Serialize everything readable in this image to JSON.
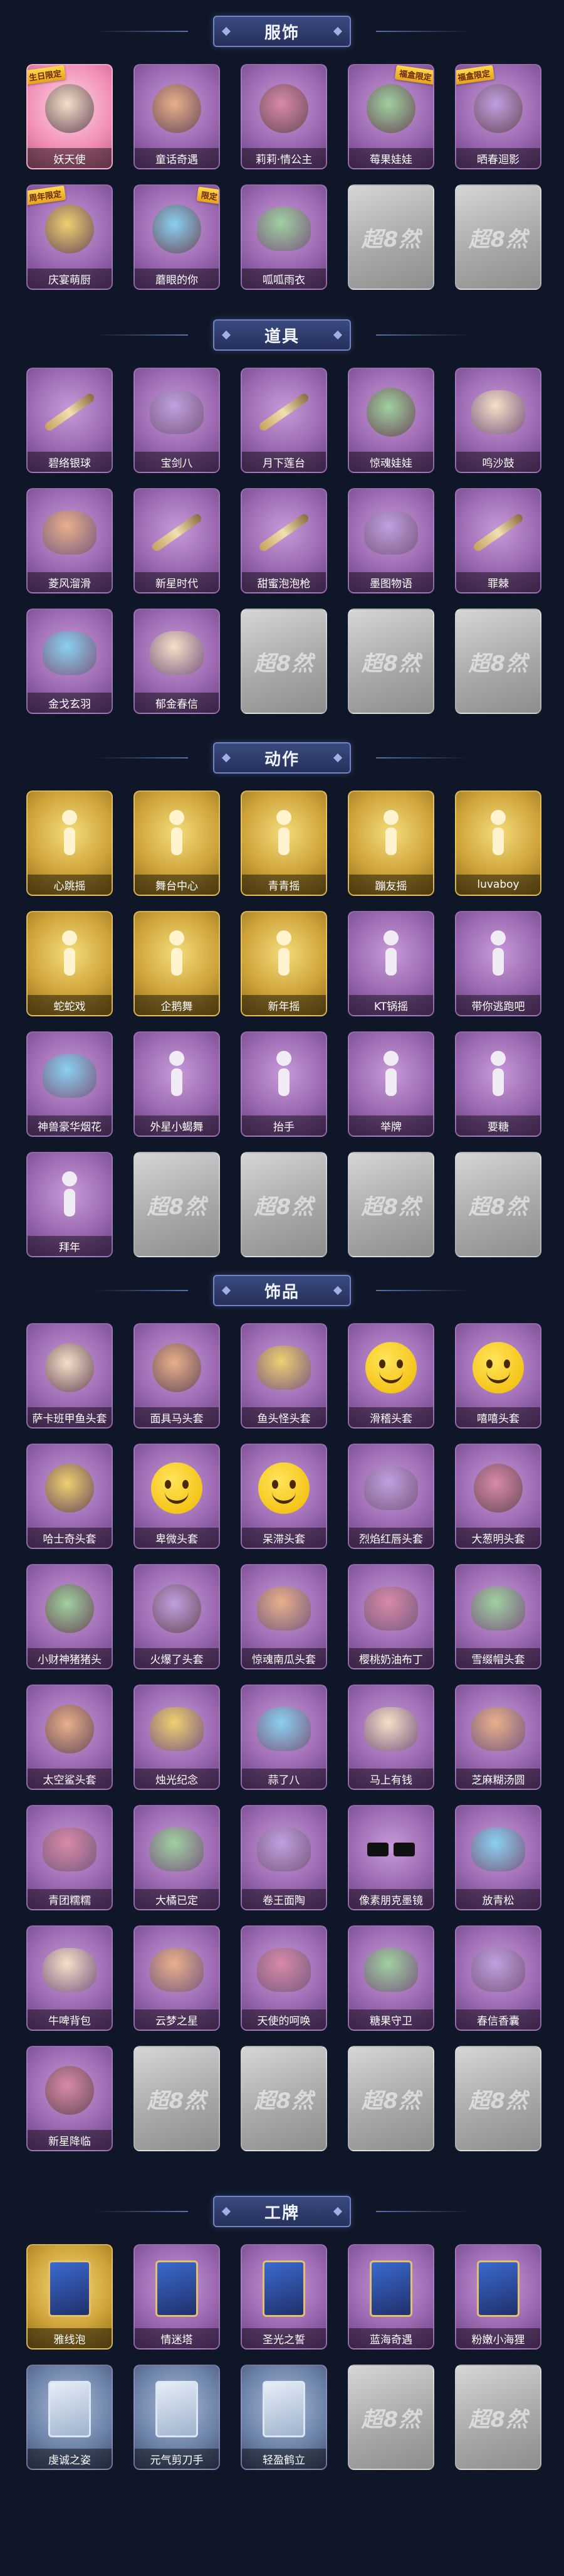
{
  "sections": [
    {
      "title": "服饰",
      "items": [
        {
          "label": "妖天使",
          "rarity": "pink",
          "icon": "angel-avatar-icon",
          "badge": "生日限定"
        },
        {
          "label": "童话奇遇",
          "rarity": "purple",
          "icon": "fairytale-girl-icon",
          "badge": ""
        },
        {
          "label": "莉莉·情公主",
          "rarity": "purple",
          "icon": "pink-princess-icon",
          "badge": ""
        },
        {
          "label": "莓果娃娃",
          "rarity": "purple",
          "icon": "berry-doll-icon",
          "badge": "福盒限定"
        },
        {
          "label": "晒春迴影",
          "rarity": "purple",
          "icon": "spring-boy-icon",
          "badge": "福盒限定"
        },
        {
          "label": "庆宴萌厨",
          "rarity": "purple",
          "icon": "chef-girl-icon",
          "badge": "周年限定"
        },
        {
          "label": "蘑眼的你",
          "rarity": "purple",
          "icon": "hat-girl-icon",
          "badge": "限定"
        },
        {
          "label": "呱呱雨衣",
          "rarity": "purple",
          "icon": "frog-raincoat-icon",
          "badge": ""
        },
        {
          "label": "",
          "rarity": "empty"
        },
        {
          "label": "",
          "rarity": "empty"
        }
      ]
    },
    {
      "title": "道具",
      "items": [
        {
          "label": "碧络银球",
          "rarity": "purple",
          "icon": "bow-weapon-icon"
        },
        {
          "label": "宝剑八",
          "rarity": "purple",
          "icon": "heart-frame-icon"
        },
        {
          "label": "月下莲台",
          "rarity": "purple",
          "icon": "moon-scepter-icon"
        },
        {
          "label": "惊魂娃娃",
          "rarity": "purple",
          "icon": "skull-doll-icon"
        },
        {
          "label": "鸣沙鼓",
          "rarity": "purple",
          "icon": "dreamcatcher-icon"
        },
        {
          "label": "菱风溜滑",
          "rarity": "purple",
          "icon": "ice-skates-icon"
        },
        {
          "label": "新星时代",
          "rarity": "purple",
          "icon": "revolver-icon"
        },
        {
          "label": "甜蜜泡泡枪",
          "rarity": "purple",
          "icon": "bubble-gun-icon"
        },
        {
          "label": "墨图物语",
          "rarity": "purple",
          "icon": "medkit-icon"
        },
        {
          "label": "罪棘",
          "rarity": "purple",
          "icon": "staff-icon"
        },
        {
          "label": "金戈玄羽",
          "rarity": "purple",
          "icon": "lantern-icon"
        },
        {
          "label": "郁金春信",
          "rarity": "purple",
          "icon": "fan-icon"
        },
        {
          "label": "",
          "rarity": "empty"
        },
        {
          "label": "",
          "rarity": "empty"
        },
        {
          "label": "",
          "rarity": "empty"
        }
      ]
    },
    {
      "title": "动作",
      "items": [
        {
          "label": "心跳摇",
          "rarity": "gold",
          "icon": "pose-icon"
        },
        {
          "label": "舞台中心",
          "rarity": "gold",
          "icon": "pose-icon"
        },
        {
          "label": "青青摇",
          "rarity": "gold",
          "icon": "pose-icon"
        },
        {
          "label": "蹦友摇",
          "rarity": "gold",
          "icon": "pose-icon"
        },
        {
          "label": "luvaboy",
          "rarity": "gold",
          "icon": "pose-icon"
        },
        {
          "label": "蛇蛇戏",
          "rarity": "gold",
          "icon": "pose-icon"
        },
        {
          "label": "企鹅舞",
          "rarity": "gold",
          "icon": "pose-icon"
        },
        {
          "label": "新年摇",
          "rarity": "gold",
          "icon": "pose-icon"
        },
        {
          "label": "KT锅摇",
          "rarity": "purple",
          "icon": "pose-icon"
        },
        {
          "label": "带你逃跑吧",
          "rarity": "purple",
          "icon": "pose-icon"
        },
        {
          "label": "神兽豪华烟花",
          "rarity": "purple",
          "icon": "firework-icon"
        },
        {
          "label": "外星小蝎舞",
          "rarity": "purple",
          "icon": "pose-icon"
        },
        {
          "label": "抬手",
          "rarity": "purple",
          "icon": "pose-icon"
        },
        {
          "label": "举牌",
          "rarity": "purple",
          "icon": "sign-pose-icon"
        },
        {
          "label": "要糖",
          "rarity": "purple",
          "icon": "pose-icon"
        },
        {
          "label": "拜年",
          "rarity": "purple",
          "icon": "pose-icon"
        },
        {
          "label": "",
          "rarity": "empty"
        },
        {
          "label": "",
          "rarity": "empty"
        },
        {
          "label": "",
          "rarity": "empty"
        },
        {
          "label": "",
          "rarity": "empty"
        }
      ]
    },
    {
      "title": "饰品",
      "items": [
        {
          "label": "萨卡班甲鱼头套",
          "rarity": "purple",
          "icon": "fish-head-icon"
        },
        {
          "label": "面具马头套",
          "rarity": "purple",
          "icon": "horse-head-icon"
        },
        {
          "label": "鱼头怪头套",
          "rarity": "purple",
          "icon": "fish-monster-icon"
        },
        {
          "label": "滑稽头套",
          "rarity": "purple",
          "icon": "emoji-smile-icon"
        },
        {
          "label": "嘻嘻头套",
          "rarity": "purple",
          "icon": "emoji-grin-icon"
        },
        {
          "label": "哈士奇头套",
          "rarity": "purple",
          "icon": "husky-head-icon"
        },
        {
          "label": "卑微头套",
          "rarity": "purple",
          "icon": "emoji-sad-icon"
        },
        {
          "label": "呆滞头套",
          "rarity": "purple",
          "icon": "emoji-stare-icon"
        },
        {
          "label": "烈焰红唇头套",
          "rarity": "purple",
          "icon": "sunglasses-pika-icon"
        },
        {
          "label": "大葱明头套",
          "rarity": "purple",
          "icon": "scallion-head-icon"
        },
        {
          "label": "小财神猪猪头",
          "rarity": "purple",
          "icon": "pig-head-icon"
        },
        {
          "label": "火爆了头套",
          "rarity": "purple",
          "icon": "fire-head-icon"
        },
        {
          "label": "惊魂南瓜头套",
          "rarity": "purple",
          "icon": "pumpkin-icon"
        },
        {
          "label": "樱桃奶油布丁",
          "rarity": "purple",
          "icon": "pudding-icon"
        },
        {
          "label": "雪缀帽头套",
          "rarity": "purple",
          "icon": "snow-hat-icon"
        },
        {
          "label": "太空鲨头套",
          "rarity": "purple",
          "icon": "shark-head-icon"
        },
        {
          "label": "烛光纪念",
          "rarity": "purple",
          "icon": "candle-icon"
        },
        {
          "label": "蒜了八",
          "rarity": "purple",
          "icon": "garlic-icon"
        },
        {
          "label": "马上有钱",
          "rarity": "purple",
          "icon": "horse-money-icon"
        },
        {
          "label": "芝麻糊汤圆",
          "rarity": "purple",
          "icon": "dumpling-icon"
        },
        {
          "label": "青团糯糯",
          "rarity": "purple",
          "icon": "qingtuan-icon"
        },
        {
          "label": "大橘已定",
          "rarity": "purple",
          "icon": "orange-icon"
        },
        {
          "label": "卷王面陶",
          "rarity": "purple",
          "icon": "bread-roll-icon"
        },
        {
          "label": "像素朋克墨镜",
          "rarity": "purple",
          "icon": "pixel-glasses-icon"
        },
        {
          "label": "放青松",
          "rarity": "purple",
          "icon": "pine-icon"
        },
        {
          "label": "牛啤背包",
          "rarity": "purple",
          "icon": "cake-backpack-icon"
        },
        {
          "label": "云梦之星",
          "rarity": "purple",
          "icon": "unicorn-star-icon"
        },
        {
          "label": "天使的呵唤",
          "rarity": "purple",
          "icon": "angel-wings-icon"
        },
        {
          "label": "糖果守卫",
          "rarity": "purple",
          "icon": "lantern-charm-icon"
        },
        {
          "label": "春信香囊",
          "rarity": "purple",
          "icon": "sachet-icon"
        },
        {
          "label": "新星降临",
          "rarity": "purple",
          "icon": "star-doll-icon"
        },
        {
          "label": "",
          "rarity": "empty"
        },
        {
          "label": "",
          "rarity": "empty"
        },
        {
          "label": "",
          "rarity": "empty"
        },
        {
          "label": "",
          "rarity": "empty"
        }
      ]
    },
    {
      "title": "工牌",
      "items": [
        {
          "label": "雅线泡",
          "rarity": "gold",
          "icon": "card-icon"
        },
        {
          "label": "情迷塔",
          "rarity": "purple",
          "icon": "card-icon"
        },
        {
          "label": "圣光之誓",
          "rarity": "purple",
          "icon": "card-icon"
        },
        {
          "label": "蓝海奇遇",
          "rarity": "purple",
          "icon": "card-icon"
        },
        {
          "label": "粉嫩小海狸",
          "rarity": "purple",
          "icon": "card-icon"
        },
        {
          "label": "虔诚之姿",
          "rarity": "blue",
          "icon": "silhouette-card-icon"
        },
        {
          "label": "元气剪刀手",
          "rarity": "blue",
          "icon": "silhouette-card-icon"
        },
        {
          "label": "轻盈鹤立",
          "rarity": "blue",
          "icon": "silhouette-card-icon"
        },
        {
          "label": "",
          "rarity": "empty"
        },
        {
          "label": "",
          "rarity": "empty"
        }
      ]
    }
  ],
  "placeholder_watermark": "超8然"
}
